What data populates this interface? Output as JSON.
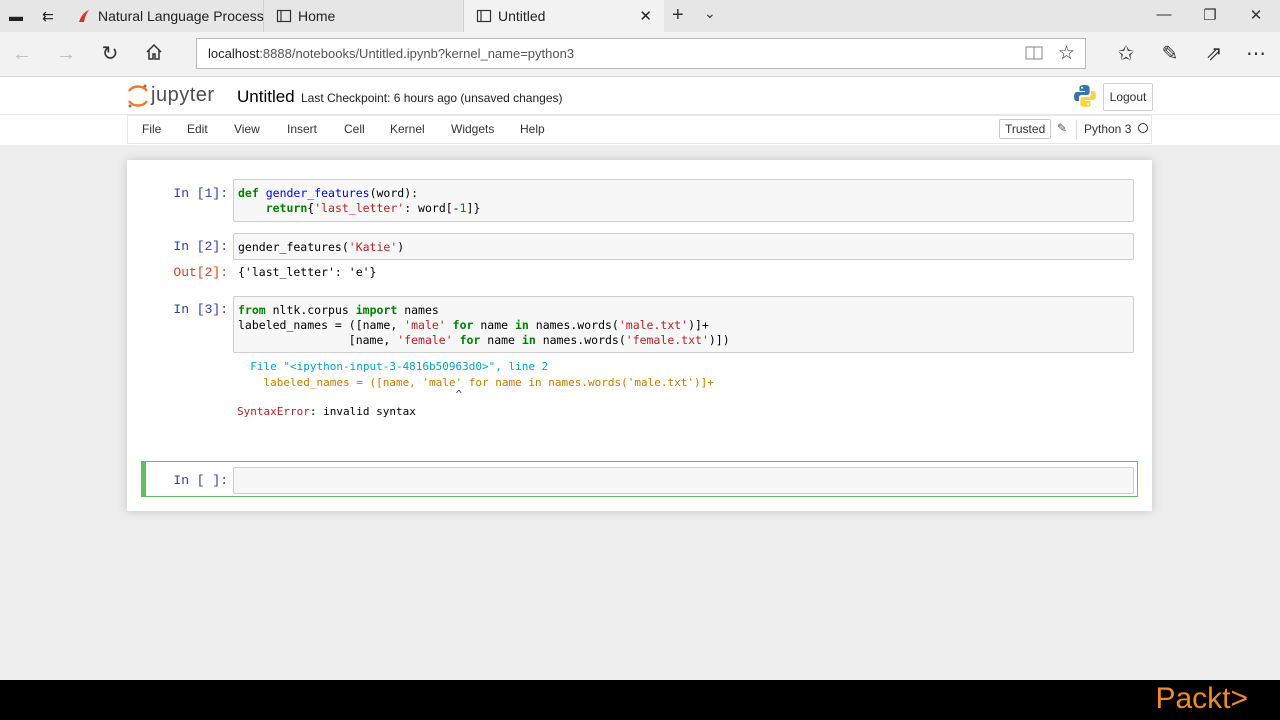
{
  "browser": {
    "tabs": [
      {
        "title": "Natural Language Processir",
        "favicon": "pdf-favicon-icon",
        "active": false
      },
      {
        "title": "Home",
        "favicon": "page-icon",
        "active": false
      },
      {
        "title": "Untitled",
        "favicon": "page-icon",
        "active": true
      }
    ],
    "address": {
      "host": "localhost",
      "path": ":8888/notebooks/Untitled.ipynb?kernel_name=python3"
    }
  },
  "jupyter": {
    "logo_text": "jupyter",
    "notebook_title": "Untitled",
    "checkpoint": "Last Checkpoint: 6 hours ago (unsaved changes)",
    "logout_label": "Logout",
    "menu": [
      "File",
      "Edit",
      "View",
      "Insert",
      "Cell",
      "Kernel",
      "Widgets",
      "Help"
    ],
    "trusted_label": "Trusted",
    "kernel_name": "Python 3"
  },
  "cells": {
    "c1": {
      "prompt": "In [1]:",
      "lines": [
        "def gender_features(word):",
        "    return{'last_letter': word[-1]}"
      ]
    },
    "c2": {
      "prompt": "In [2]:",
      "line": "gender_features('Katie')",
      "out_prompt": "Out[2]:",
      "output": "{'last_letter': 'e'}"
    },
    "c3": {
      "prompt": "In [3]:",
      "lines": [
        "from nltk.corpus import names",
        "labeled_names = ([name, 'male' for name in names.words('male.txt')]+",
        "                [name, 'female' for name in names.words('female.txt')])"
      ],
      "error": {
        "file_line": "  File \"<ipython-input-3-4816b50963d0>\", line 2",
        "code_line": "    labeled_names = ([name, 'male' for name in names.words('male.txt')]+",
        "caret": "                                 ^",
        "message_type": "SyntaxError",
        "message": ": invalid syntax"
      }
    },
    "c4": {
      "prompt": "In [ ]:"
    }
  },
  "watermark": "Packt>",
  "colors": {
    "prompt_in": "#303f9f",
    "prompt_out": "#d84315",
    "selected_cell": "#66bb6a",
    "packt": "#f08a2b"
  }
}
